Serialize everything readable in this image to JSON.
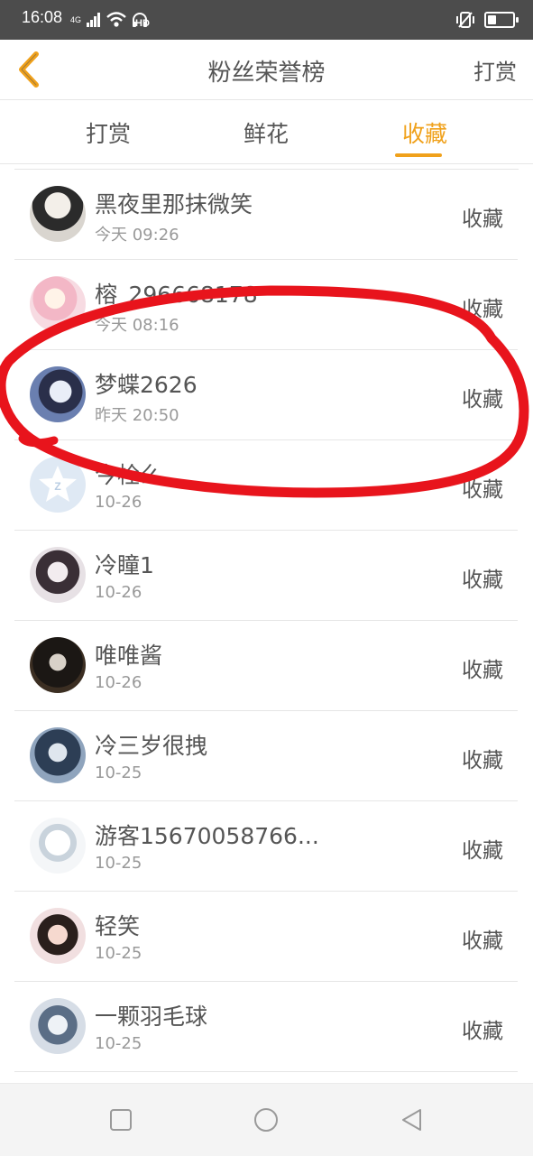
{
  "status": {
    "time": "16:08",
    "net": "4G",
    "hd": "HD"
  },
  "header": {
    "title": "粉丝荣誉榜",
    "action": "打赏"
  },
  "tabs": [
    {
      "label": "打赏"
    },
    {
      "label": "鲜花"
    },
    {
      "label": "收藏"
    }
  ],
  "active_tab": "收藏",
  "rows": [
    {
      "name": "黑夜里那抹微笑",
      "time": "今天 09:26",
      "action": "收藏"
    },
    {
      "name": "榕_296668178",
      "time": "今天 08:16",
      "action": "收藏"
    },
    {
      "name": "梦蝶2626",
      "time": "昨天 20:50",
      "action": "收藏"
    },
    {
      "name": "今栓么",
      "time": "10-26",
      "action": "收藏"
    },
    {
      "name": "冷瞳1",
      "time": "10-26",
      "action": "收藏"
    },
    {
      "name": "唯唯酱",
      "time": "10-26",
      "action": "收藏"
    },
    {
      "name": "冷三岁很拽",
      "time": "10-25",
      "action": "收藏"
    },
    {
      "name": "游客15670058766...",
      "time": "10-25",
      "action": "收藏"
    },
    {
      "name": "轻笑",
      "time": "10-25",
      "action": "收藏"
    },
    {
      "name": "一颗羽毛球",
      "time": "10-25",
      "action": "收藏"
    }
  ],
  "colors": {
    "accent": "#f0a11b",
    "annotation": "#e8141c",
    "statusbar": "#4c4c4c"
  },
  "battery_level": 0.35,
  "icons": {
    "back": "chevron-left-icon",
    "nav_recents": "square-icon",
    "nav_home": "circle-icon",
    "nav_back": "triangle-left-icon"
  }
}
